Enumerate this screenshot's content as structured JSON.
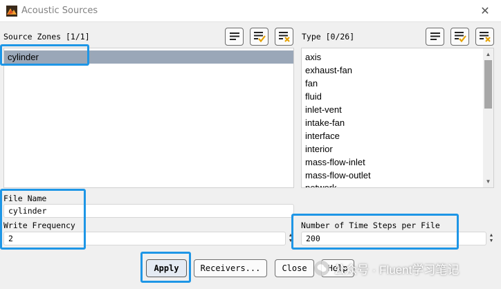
{
  "window": {
    "title": "Acoustic Sources",
    "close_glyph": "✕"
  },
  "source_zones": {
    "label": "Source Zones [1/1]",
    "items": [
      {
        "label": "cylinder",
        "selected": true
      }
    ]
  },
  "type": {
    "label": "Type [0/26]",
    "items": [
      "axis",
      "exhaust-fan",
      "fan",
      "fluid",
      "inlet-vent",
      "intake-fan",
      "interface",
      "interior",
      "mass-flow-inlet",
      "mass-flow-outlet",
      "network"
    ]
  },
  "fields": {
    "file_name": {
      "label": "File Name",
      "value": "cylinder"
    },
    "write_frequency": {
      "label": "Write Frequency",
      "value": "2"
    },
    "time_steps": {
      "label": "Number of Time Steps per File",
      "value": "200"
    }
  },
  "buttons": {
    "apply": "Apply",
    "receivers": "Receivers...",
    "close": "Close",
    "help": "Help"
  },
  "icons": {
    "list": "list-icon",
    "select_all": "select-all-icon",
    "deselect_all": "deselect-all-icon"
  },
  "colors": {
    "highlight": "#1e96e6",
    "selection": "#9aa7b8",
    "check": "#e6a100",
    "x_mark": "#e6a100"
  },
  "watermark": {
    "text": "公众号 · Fluent学习笔记"
  }
}
